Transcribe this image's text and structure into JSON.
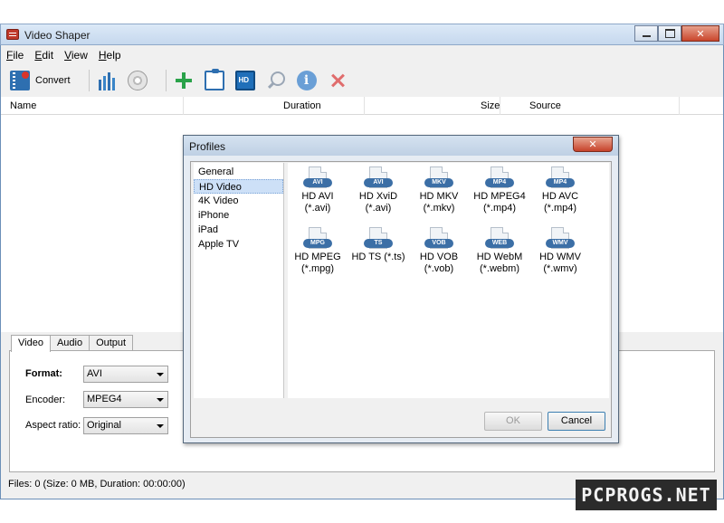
{
  "window": {
    "title": "Video Shaper"
  },
  "menu": {
    "file": "File",
    "edit": "Edit",
    "view": "View",
    "help": "Help"
  },
  "toolbar": {
    "convert_label": "Convert"
  },
  "columns": {
    "name": "Name",
    "duration": "Duration",
    "size": "Size",
    "source": "Source"
  },
  "tabs": {
    "video": "Video",
    "audio": "Audio",
    "output": "Output"
  },
  "settings": {
    "format_label": "Format:",
    "format_value": "AVI",
    "encoder_label": "Encoder:",
    "encoder_value": "MPEG4",
    "aspect_label": "Aspect ratio:",
    "aspect_value": "Original"
  },
  "status": {
    "text": "Files: 0 (Size: 0 MB, Duration: 00:00:00)"
  },
  "dialog": {
    "title": "Profiles",
    "categories": [
      "General",
      "HD Video",
      "4K Video",
      "iPhone",
      "iPad",
      "Apple TV"
    ],
    "selected_category": "HD Video",
    "profiles": [
      {
        "badge": "AVI",
        "line1": "HD AVI",
        "line2": "(*.avi)"
      },
      {
        "badge": "AVI",
        "line1": "HD XviD",
        "line2": "(*.avi)"
      },
      {
        "badge": "MKV",
        "line1": "HD MKV",
        "line2": "(*.mkv)"
      },
      {
        "badge": "MP4",
        "line1": "HD MPEG4",
        "line2": "(*.mp4)"
      },
      {
        "badge": "MP4",
        "line1": "HD AVC",
        "line2": "(*.mp4)"
      },
      {
        "badge": "MPG",
        "line1": "HD MPEG",
        "line2": "(*.mpg)"
      },
      {
        "badge": "TS",
        "line1": "HD TS (*.ts)",
        "line2": ""
      },
      {
        "badge": "VOB",
        "line1": "HD VOB",
        "line2": "(*.vob)"
      },
      {
        "badge": "WEB",
        "line1": "HD WebM",
        "line2": "(*.webm)"
      },
      {
        "badge": "WMV",
        "line1": "HD WMV",
        "line2": "(*.wmv)"
      }
    ],
    "ok_label": "OK",
    "cancel_label": "Cancel"
  },
  "watermark": {
    "text": "PCPROGS.NET"
  }
}
